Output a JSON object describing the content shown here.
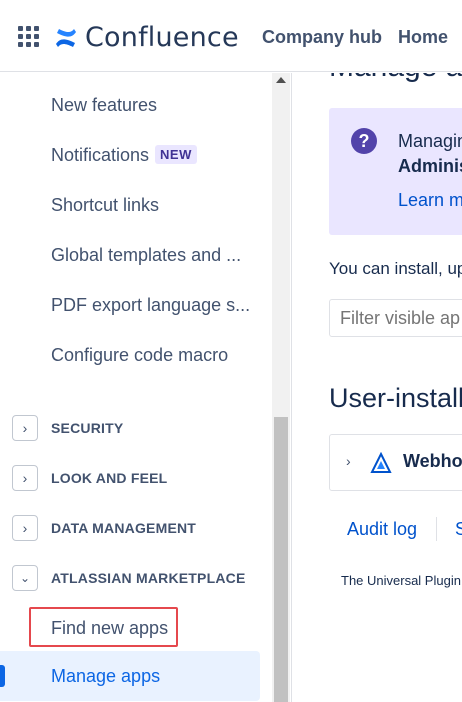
{
  "header": {
    "app_name": "Confluence",
    "nav": [
      "Company hub",
      "Home"
    ]
  },
  "sidebar": {
    "links": [
      {
        "label": "New features"
      },
      {
        "label": "Notifications",
        "badge": "NEW"
      },
      {
        "label": "Shortcut links"
      },
      {
        "label": "Global templates and ..."
      },
      {
        "label": "PDF export language s..."
      },
      {
        "label": "Configure code macro"
      }
    ],
    "sections": [
      {
        "label": "SECURITY",
        "expanded": false
      },
      {
        "label": "LOOK AND FEEL",
        "expanded": false
      },
      {
        "label": "DATA MANAGEMENT",
        "expanded": false
      },
      {
        "label": "ATLASSIAN MARKETPLACE",
        "expanded": true
      }
    ],
    "marketplace_items": [
      {
        "label": "Find new apps",
        "highlighted": true
      },
      {
        "label": "Manage apps",
        "active": true
      }
    ]
  },
  "main": {
    "title": "Manage apps",
    "info_panel": {
      "line1": "Managing",
      "line2": "Adminis",
      "link": "Learn m"
    },
    "install_text": "You can install, up",
    "filter_input": {
      "placeholder": "Filter visible ap"
    },
    "user_installed_title": "User-install",
    "apps": [
      {
        "name": "Webhoo"
      }
    ],
    "footer_links": [
      "Audit log",
      "S"
    ],
    "footer_note": "The Universal Plugin"
  },
  "colors": {
    "accent": "#0c66e4",
    "badge_bg": "#eae6ff",
    "badge_text": "#403294",
    "highlight_border": "#e5484d",
    "info_bg": "#eae6ff",
    "info_icon": "#5243aa"
  }
}
